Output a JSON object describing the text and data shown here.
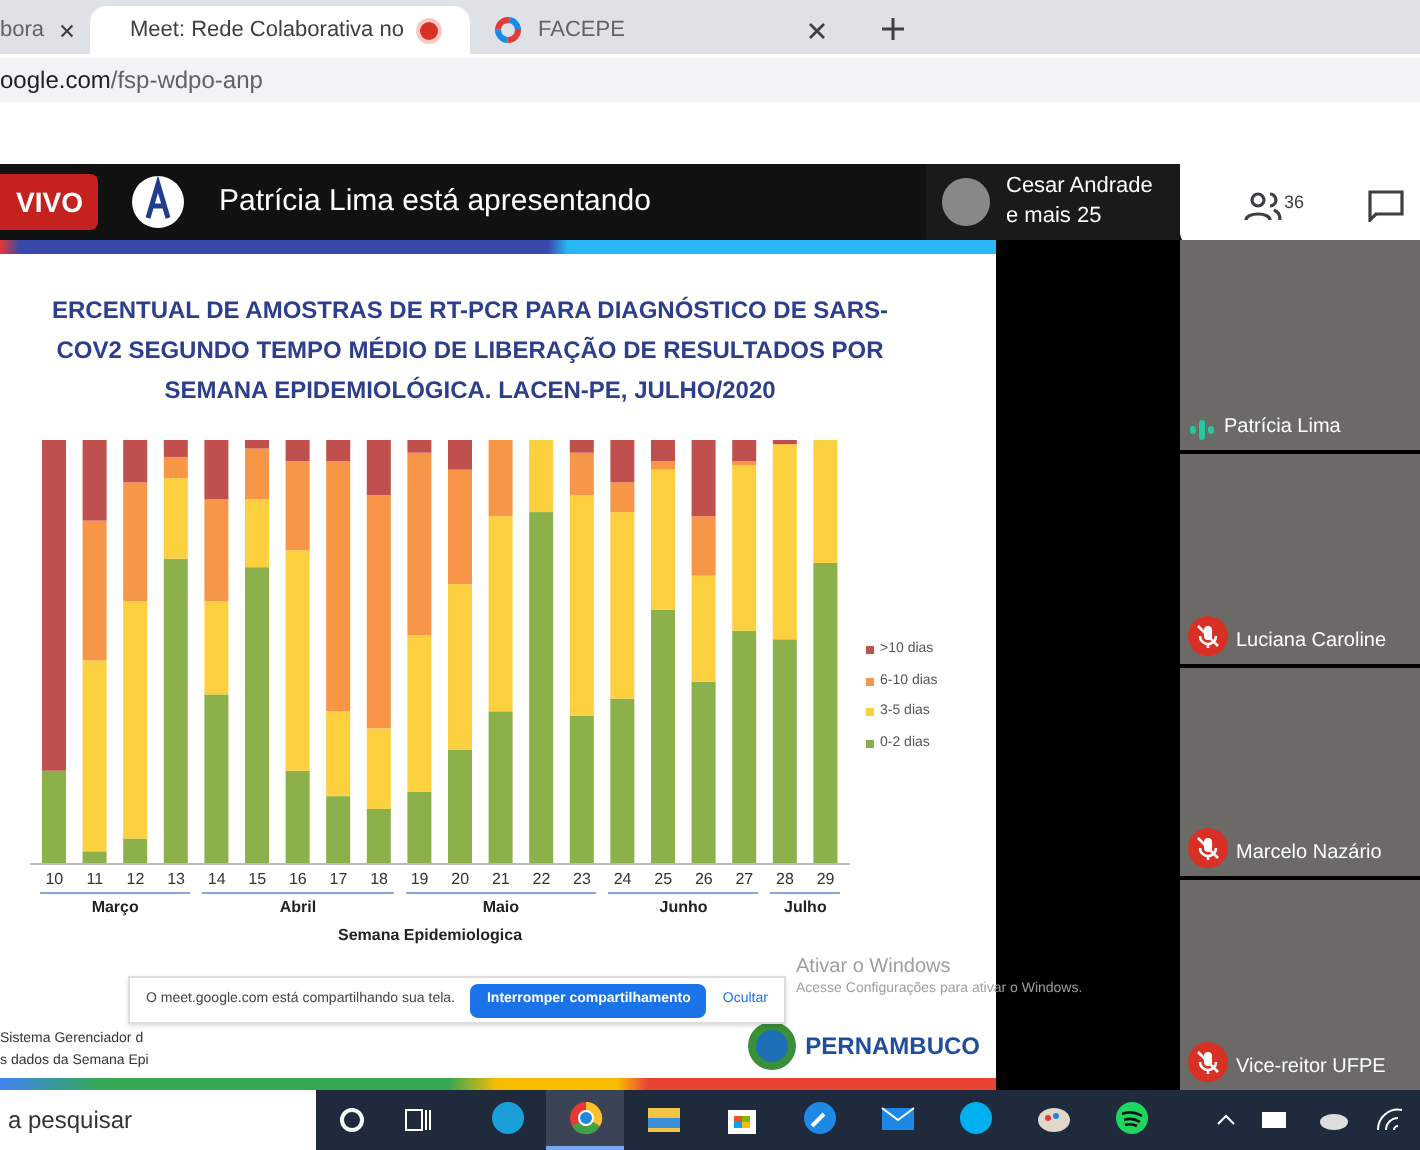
{
  "browser": {
    "tabs": [
      {
        "title": "bora",
        "selected": false,
        "recording": false,
        "kind": "plain"
      },
      {
        "title": "Meet: Rede Colaborativa no",
        "selected": true,
        "recording": true,
        "kind": "meet"
      },
      {
        "title": "FACEPE",
        "selected": false,
        "recording": false,
        "kind": "facepe"
      }
    ],
    "url_host": "oogle.com",
    "url_path": "/fsp-wdpo-anp"
  },
  "meeting_bar": {
    "live_badge": "VIVO",
    "presenting": "Patrícia Lima está apresentando",
    "viewer_name": "Cesar Andrade",
    "viewer_more": "e mais 25",
    "participants_count": "36"
  },
  "slide": {
    "title_lines": [
      "ERCENTUAL DE AMOSTRAS DE RT-PCR PARA DIAGNÓSTICO DE SARS-",
      "COV2 SEGUNDO TEMPO MÉDIO DE LIBERAÇÃO DE RESULTADOS POR",
      "SEMANA EPIDEMIOLÓGICA. LACEN-PE, JULHO/2020"
    ],
    "weeks": [
      "10",
      "11",
      "12",
      "13",
      "14",
      "15",
      "16",
      "17",
      "18",
      "19",
      "20",
      "21",
      "22",
      "23",
      "24",
      "25",
      "26",
      "27",
      "28",
      "29"
    ],
    "months": [
      "Março",
      "Abril",
      "Maio",
      "Junho",
      "Julho"
    ],
    "axis_title": "Semana Epidemiologica",
    "legend": [
      {
        "label": ">10 dias",
        "color": "#c0504d"
      },
      {
        "label": "6-10 dias",
        "color": "#f79646"
      },
      {
        "label": "3-5 dias",
        "color": "#fcd03f"
      },
      {
        "label": "0-2 dias",
        "color": "#8cb04a"
      }
    ],
    "footer_lines": [
      "Sistema Gerenciador d",
      "s dados da Semana Epi"
    ],
    "logo_text": "PERNAMBUCO"
  },
  "share_notice": {
    "text": "O meet.google.com está compartilhando sua tela.",
    "stop_button": "Interromper compartilhamento",
    "hide_link": "Ocultar"
  },
  "windows_notice": {
    "title": "Ativar o Windows",
    "text": "Acesse Configurações para ativar o Windows."
  },
  "tiles": [
    {
      "name": "Patrícia Lima",
      "muted": false
    },
    {
      "name": "Luciana Caroline",
      "muted": true
    },
    {
      "name": "Marcelo Nazário",
      "muted": true
    },
    {
      "name": "Vice-reitor UFPE",
      "muted": true
    }
  ],
  "taskbar": {
    "search_placeholder": "a pesquisar",
    "apps": [
      {
        "kind": "edge",
        "active": false
      },
      {
        "kind": "chrome",
        "active": true
      },
      {
        "kind": "folder",
        "active": false
      },
      {
        "kind": "store",
        "active": false
      },
      {
        "kind": "tool",
        "active": false
      },
      {
        "kind": "mail",
        "active": false
      },
      {
        "kind": "skype",
        "active": false
      },
      {
        "kind": "paint",
        "active": false
      },
      {
        "kind": "spotify",
        "active": false
      }
    ]
  }
}
